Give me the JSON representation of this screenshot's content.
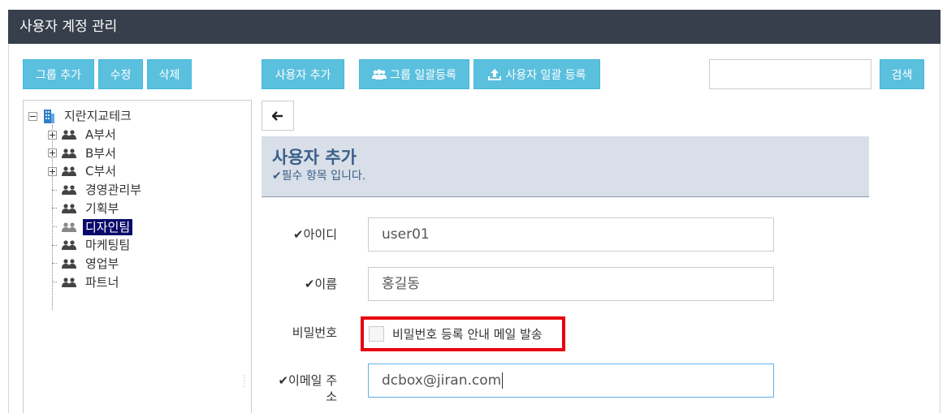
{
  "window": {
    "title": "사용자 계정 관리"
  },
  "toolbar": {
    "add_group": "그룹 추가",
    "edit": "수정",
    "delete": "삭제",
    "add_user": "사용자 추가",
    "bulk_group": "그룹 일괄등록",
    "bulk_user": "사용자 일괄 등록",
    "search_value": "",
    "search_button": "검색"
  },
  "tree": {
    "root": "지란지교테크",
    "items": [
      {
        "label": "A부서",
        "expandable": true,
        "selected": false
      },
      {
        "label": "B부서",
        "expandable": true,
        "selected": false
      },
      {
        "label": "C부서",
        "expandable": true,
        "selected": false
      },
      {
        "label": "경영관리부",
        "expandable": false,
        "selected": false
      },
      {
        "label": "기획부",
        "expandable": false,
        "selected": false
      },
      {
        "label": "디자인팀",
        "expandable": false,
        "selected": true
      },
      {
        "label": "마케팅팀",
        "expandable": false,
        "selected": false
      },
      {
        "label": "영업부",
        "expandable": false,
        "selected": false
      },
      {
        "label": "파트너",
        "expandable": false,
        "selected": false
      }
    ]
  },
  "form": {
    "title": "사용자 추가",
    "subtitle": "필수 항목 입니다.",
    "id_label": "아이디",
    "id_value": "user01",
    "name_label": "이름",
    "name_value": "홍길동",
    "password_label": "비밀번호",
    "password_checkbox_label": "비밀번호 등록 안내 메일 발송",
    "email_label_line1": "이메일 주",
    "email_label_line2": "소",
    "email_value": "dcbox@jiran.com"
  },
  "colors": {
    "titlebar": "#363f4b",
    "button": "#5bc0de",
    "header_bg": "#d9dfe8",
    "header_text": "#3a5f8a",
    "highlight_box": "#e8000f",
    "tree_selected": "#0a0a6b"
  }
}
